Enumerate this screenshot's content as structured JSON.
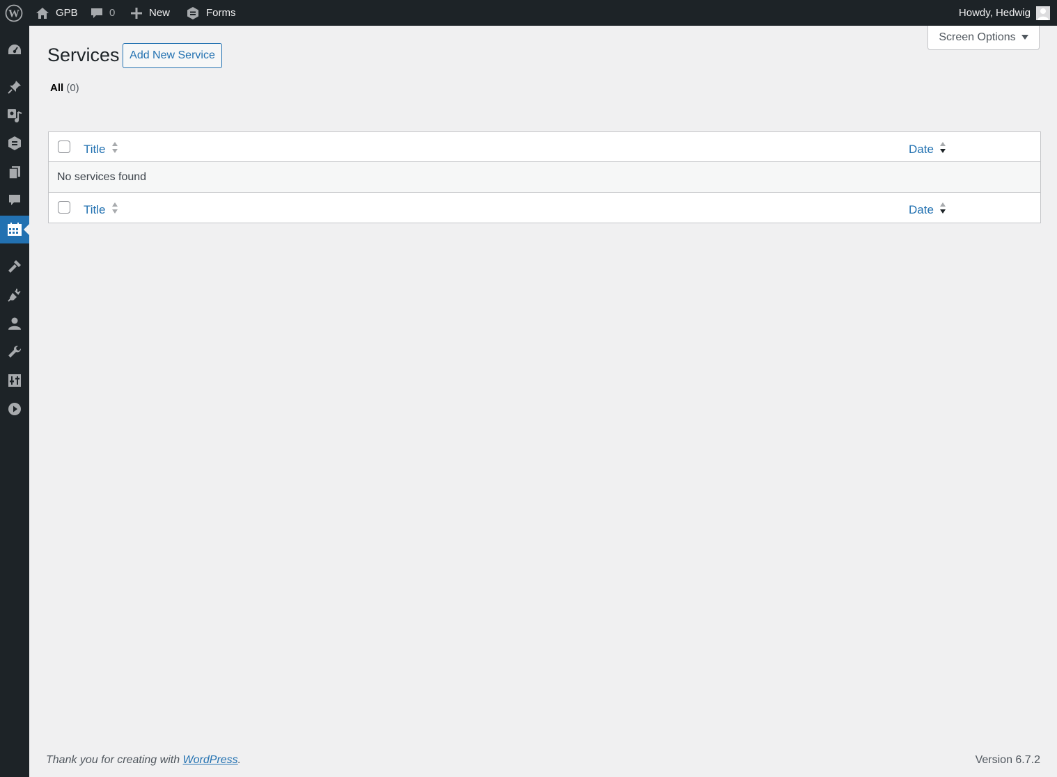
{
  "admin_bar": {
    "site_name": "GPB",
    "comments_count": "0",
    "new_label": "New",
    "forms_label": "Forms",
    "howdy": "Howdy, Hedwig"
  },
  "sidebar": {
    "icons": [
      "dashboard-icon",
      "pin-icon",
      "media-icon",
      "forms-icon",
      "pages-icon",
      "comments-icon",
      "calendar-icon",
      "appearance-icon",
      "plugins-icon",
      "users-icon",
      "tools-icon",
      "settings-icon",
      "play-icon"
    ],
    "current": "calendar-icon"
  },
  "screen_options": {
    "label": "Screen Options"
  },
  "page": {
    "title": "Services",
    "add_new_label": "Add New Service",
    "filter_all_label": "All",
    "filter_all_count": "(0)"
  },
  "table": {
    "columns": [
      "Title",
      "Date"
    ],
    "empty_message": "No services found"
  },
  "footer": {
    "thanks_prefix": "Thank you for creating with ",
    "wordpress_link": "WordPress",
    "thanks_suffix": ".",
    "version": "Version 6.7.2"
  },
  "colors": {
    "admin_bg": "#1d2327",
    "accent": "#2271b1",
    "page_bg": "#f0f0f1"
  }
}
